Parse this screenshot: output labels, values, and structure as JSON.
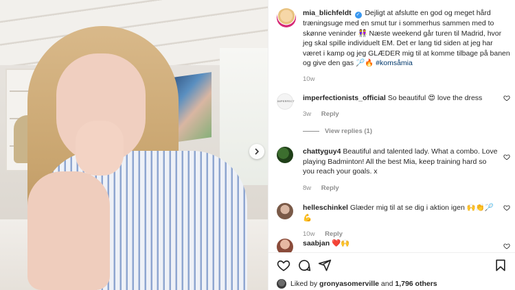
{
  "post": {
    "username": "mia_blichfeldt",
    "caption": "Dejligt at afslutte en god og meget hård træningsuge med en smut tur i sommerhus sammen med to skønne veninder 👭 Næste weekend går turen til Madrid, hvor jeg skal spille individuelt EM. Det er lang tid siden at jeg har været i kamp og jeg GLÆDER mig til at komme tilbage på banen og give den gas 🏸🔥",
    "hashtag": "#komsåmia",
    "time": "10w"
  },
  "comments": [
    {
      "username": "imperfectionists_official",
      "text": "So beautiful 😍 love the dress",
      "time": "3w",
      "reply": "Reply",
      "view_replies": "View replies (1)"
    },
    {
      "username": "chattyguy4",
      "text": "Beautiful and talented lady. What a combo. Love playing Badminton! All the best Mia, keep training hard so you reach your goals. x",
      "time": "8w",
      "reply": "Reply"
    },
    {
      "username": "helleschinkel",
      "text": "Glæder mig til at se dig i aktion igen 🙌👏🏸💪",
      "time": "10w",
      "reply": "Reply"
    },
    {
      "username": "saabjan",
      "text": "❤️🙌"
    }
  ],
  "likes": {
    "prefix": "Liked by",
    "user": "gronyasomerville",
    "connector": "and",
    "others": "1,796 others"
  },
  "icons": {
    "like": "heart-icon",
    "comment": "comment-icon",
    "share": "share-icon",
    "save": "bookmark-icon",
    "next": "chevron-right-icon"
  },
  "colors": {
    "link": "#00376b",
    "verified": "#3897f0",
    "muted": "#8e8e8e",
    "like_red": "#ed4956"
  }
}
